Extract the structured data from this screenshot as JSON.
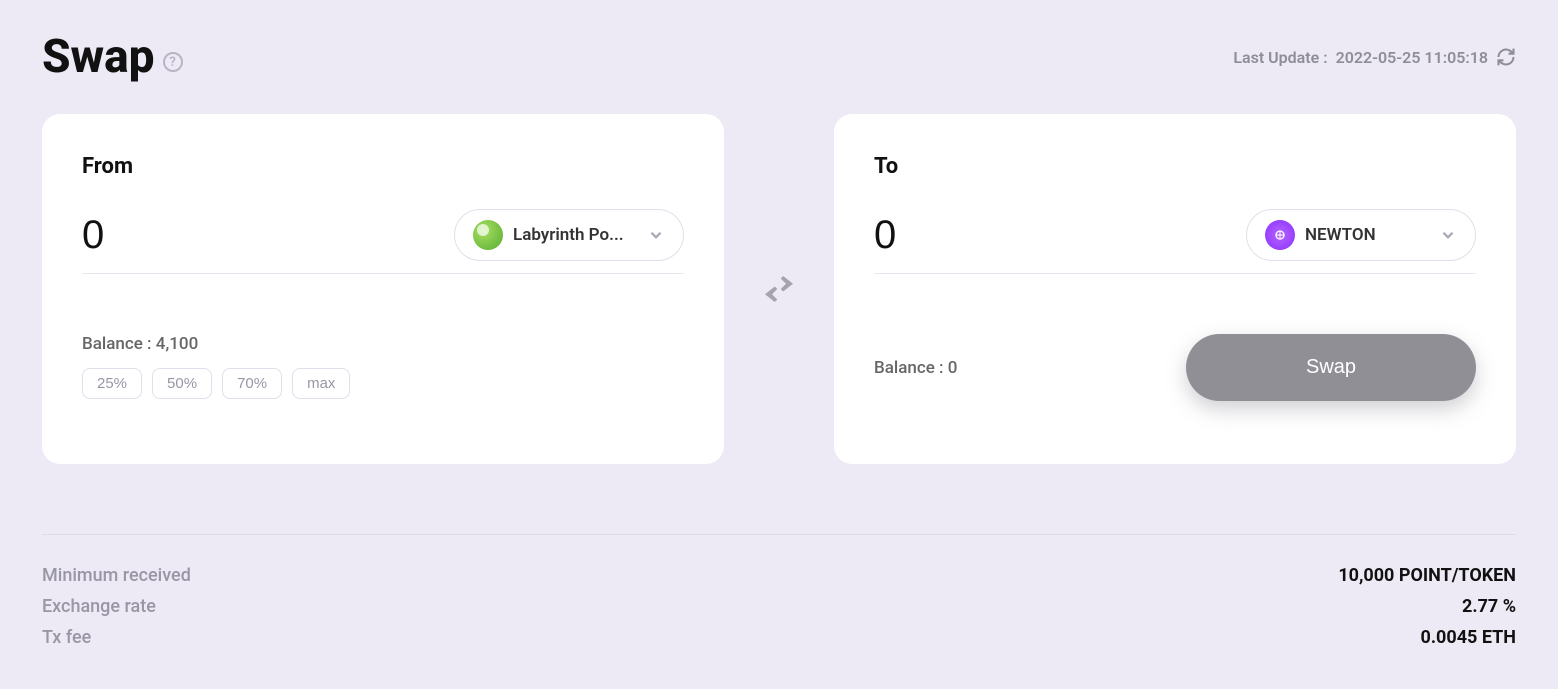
{
  "header": {
    "title": "Swap",
    "last_update_label": "Last Update :",
    "last_update_time": "2022-05-25 11:05:18"
  },
  "from": {
    "label": "From",
    "amount": "0",
    "token_name": "Labyrinth Po...",
    "balance_label": "Balance :",
    "balance": "4,100",
    "pct_buttons": [
      "25%",
      "50%",
      "70%",
      "max"
    ]
  },
  "to": {
    "label": "To",
    "amount": "0",
    "token_name": "NEWTON",
    "balance_label": "Balance :",
    "balance": "0",
    "swap_button": "Swap"
  },
  "info": {
    "minimum_received_label": "Minimum received",
    "minimum_received_value": "10,000 POINT/TOKEN",
    "exchange_rate_label": "Exchange rate",
    "exchange_rate_value": "2.77 %",
    "tx_fee_label": "Tx fee",
    "tx_fee_value": "0.0045 ETH"
  }
}
